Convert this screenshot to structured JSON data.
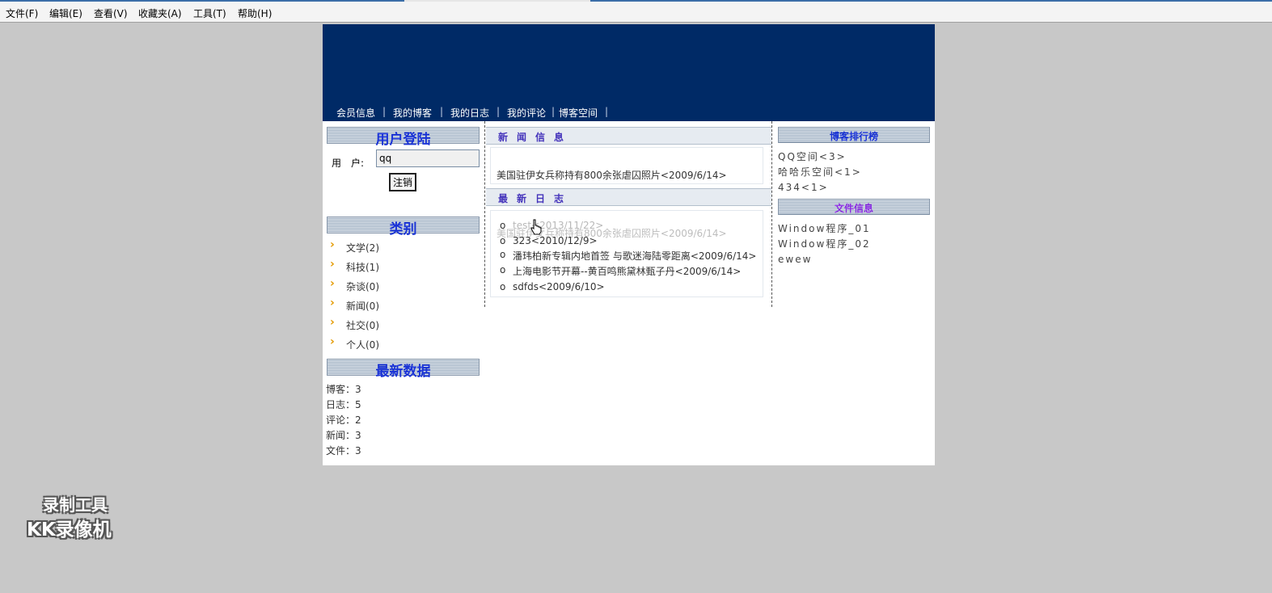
{
  "menu": [
    "文件(F)",
    "编辑(E)",
    "查看(V)",
    "收藏夹(A)",
    "工具(T)",
    "帮助(H)"
  ],
  "nav": [
    "会员信息",
    "我的博客",
    "我的日志",
    "我的评论",
    "博客空间"
  ],
  "nav_sep": "|",
  "left": {
    "login_title": "用户登陆",
    "user_label": "用　户:",
    "user_value": "qq",
    "logout_label": "注销",
    "category_title": "类别",
    "categories": [
      "文学(2)",
      "科技(1)",
      "杂谈(0)",
      "新闻(0)",
      "社交(0)",
      "个人(0)"
    ],
    "stats_title": "最新数据",
    "stats": [
      "博客：3",
      "日志：5",
      "评论：2",
      "新闻：3",
      "文件：3"
    ]
  },
  "center": {
    "news_title": "新闻信息",
    "news_items": [
      "美国驻伊女兵称持有800余张虐囚照片<2009/6/14>"
    ],
    "ghost_line": "美国驻伊女兵称持有800余张虐囚照片<2009/6/14>",
    "logs_title": "最新日志",
    "bullet": "o",
    "logs": [
      "test<2013/11/22>",
      "323<2010/12/9>",
      "潘玮柏新专辑内地首签 与歌迷海陆零距离<2009/6/14>",
      "上海电影节开幕--黄百鸣熊黛林甄子丹<2009/6/14>",
      "sdfds<2009/6/10>"
    ]
  },
  "right": {
    "rank_title": "博客排行榜",
    "rank": [
      "QQ空间<3>",
      "哈哈乐空间<1>",
      "434<1>"
    ],
    "files_title": "文件信息",
    "files": [
      "Window程序_01",
      "Window程序_02",
      "ewew"
    ]
  },
  "colors": {
    "banner": "#002a66",
    "accent_blue": "#1a33d6",
    "accent_purple": "#8a2be2",
    "arrow": "#e49a00"
  },
  "watermark": {
    "line1": "录制工具",
    "line2": "KK录像机"
  }
}
